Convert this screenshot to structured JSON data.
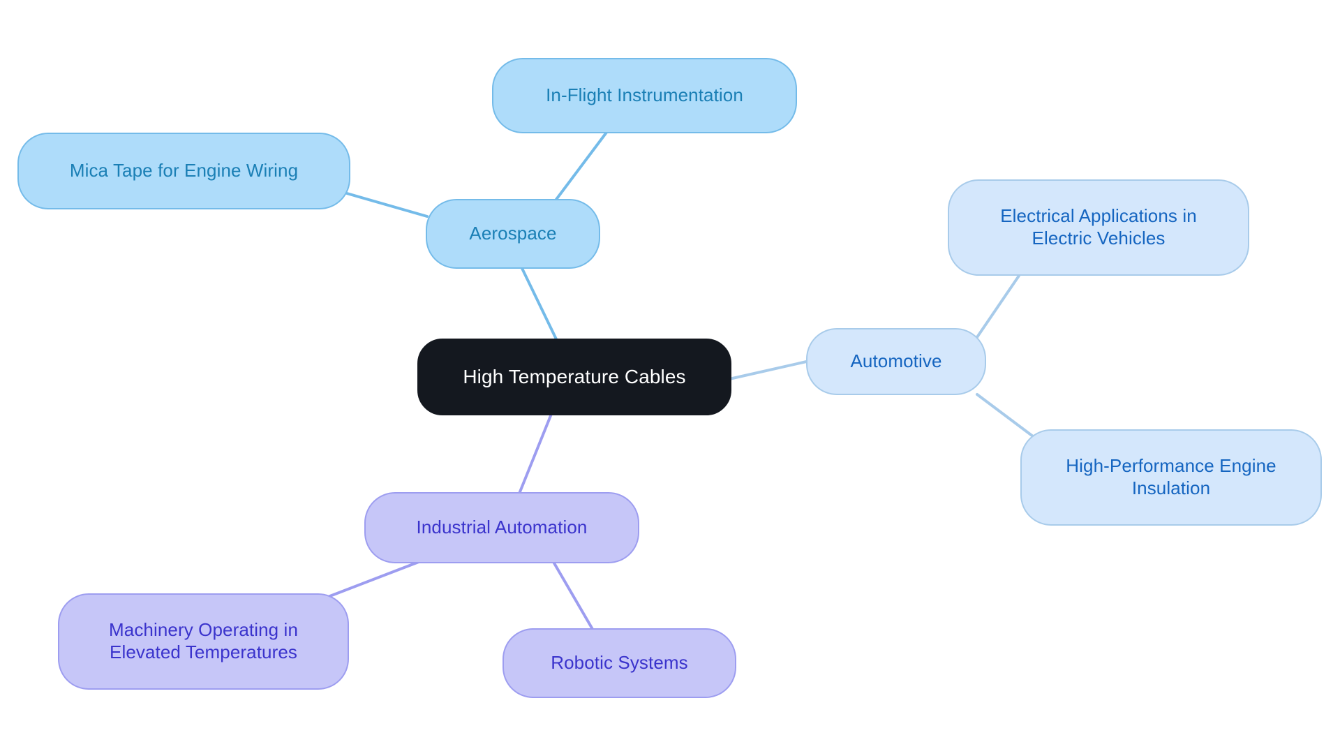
{
  "diagram": {
    "type": "mindmap",
    "title": "High Temperature Cables",
    "background_color": "#ffffff",
    "root": {
      "id": "root",
      "label": "High Temperature Cables",
      "fill": "#14181f",
      "text_color": "#ffffff"
    },
    "branches": [
      {
        "id": "aerospace",
        "label": "Aerospace",
        "fill": "#aedcfa",
        "border": "#74bbe9",
        "text_color": "#1a7fb5",
        "children": [
          {
            "id": "mica-tape",
            "label": "Mica Tape for Engine Wiring"
          },
          {
            "id": "in-flight",
            "label": "In-Flight Instrumentation"
          }
        ]
      },
      {
        "id": "automotive",
        "label": "Automotive",
        "fill": "#d4e7fc",
        "border": "#a8cbea",
        "text_color": "#1565c0",
        "children": [
          {
            "id": "ev-electrical",
            "label": "Electrical Applications in\nElectric Vehicles"
          },
          {
            "id": "engine-insulation",
            "label": "High-Performance Engine\nInsulation"
          }
        ]
      },
      {
        "id": "industrial-automation",
        "label": "Industrial Automation",
        "fill": "#c6c6f8",
        "border": "#9d9df0",
        "text_color": "#3a33cc",
        "children": [
          {
            "id": "machinery",
            "label": "Machinery Operating in\nElevated Temperatures"
          },
          {
            "id": "robotic-systems",
            "label": "Robotic Systems"
          }
        ]
      }
    ],
    "edges": [
      {
        "id": "root-aerospace",
        "from": "root",
        "to": "aerospace",
        "color": "#74bbe9"
      },
      {
        "id": "aerospace-mica",
        "from": "aerospace",
        "to": "mica-tape",
        "color": "#74bbe9"
      },
      {
        "id": "aerospace-inflight",
        "from": "aerospace",
        "to": "in-flight",
        "color": "#74bbe9"
      },
      {
        "id": "root-automotive",
        "from": "root",
        "to": "automotive",
        "color": "#a8cbea"
      },
      {
        "id": "automotive-ev",
        "from": "automotive",
        "to": "ev-electrical",
        "color": "#a8cbea"
      },
      {
        "id": "automotive-engine",
        "from": "automotive",
        "to": "engine-insulation",
        "color": "#a8cbea"
      },
      {
        "id": "root-industrial",
        "from": "root",
        "to": "industrial-automation",
        "color": "#9d9df0"
      },
      {
        "id": "industrial-machinery",
        "from": "industrial-automation",
        "to": "machinery",
        "color": "#9d9df0"
      },
      {
        "id": "industrial-robotic",
        "from": "industrial-automation",
        "to": "robotic-systems",
        "color": "#9d9df0"
      }
    ]
  }
}
